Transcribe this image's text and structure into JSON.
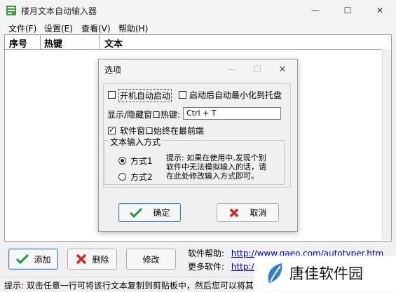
{
  "window": {
    "title": "楼月文本自动输入器",
    "minimize": "—",
    "maximize": "☐",
    "close": "✕"
  },
  "menu": [
    "文件(F)",
    "设置(E)",
    "查看(V)",
    "帮助(H)"
  ],
  "list": {
    "columns": [
      "序号",
      "热键",
      "文本"
    ]
  },
  "buttons": {
    "add": "添加",
    "delete": "删除",
    "edit": "修改"
  },
  "help": {
    "software_help_label": "软件帮助:",
    "software_help_url": "http://www.qaeo.com/autotyper.htm",
    "more_software_label": "更多软件:",
    "more_software_url": "http://"
  },
  "status_text": "提示: 双击任意一行可将该行文本复制到剪贴板中，然后您可以将其",
  "watermark": {
    "text": "唐佳软件园"
  },
  "dialog": {
    "title": "选项",
    "startup_label": "开机自动启动",
    "minimize_tray_label": "启动后自动最小化到托盘",
    "hotkey_label": "显示/隐藏窗口热键:",
    "hotkey_value": "Ctrl + T",
    "always_on_top_label": "软件窗口始终在最前端",
    "input_method_legend": "文本输入方式",
    "method1_label": "方式1",
    "method2_label": "方式2",
    "tip_text_lines": [
      "提示: 如果在使用中,发现个别",
      "软件中无法模拟输入的话，请",
      "在此处修改输入方式即可。"
    ],
    "ok_label": "确定",
    "cancel_label": "取消"
  },
  "checkbox_states": {
    "startup": false,
    "minimize_tray": false,
    "always_on_top": true
  },
  "radio_selected": "method1",
  "colors": {
    "ok_check": "#1a9a3a",
    "cancel_x": "#d6271f",
    "link": "#0000cc"
  }
}
